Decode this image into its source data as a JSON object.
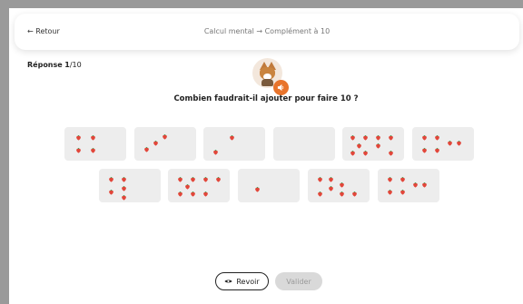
{
  "header": {
    "back_label": "← Retour",
    "breadcrumb": "Calcul mental → Complément à 10"
  },
  "progress": {
    "label": "Réponse",
    "current": "1",
    "total": "/10"
  },
  "question": "Combien faudrait-il ajouter pour faire 10 ?",
  "cards": [
    {
      "strawberries": 4
    },
    {
      "strawberries": 3
    },
    {
      "strawberries": 2
    },
    {
      "strawberries": 0
    },
    {
      "strawberries": 9
    },
    {
      "strawberries": 6
    },
    {
      "strawberries": 5
    },
    {
      "strawberries": 8
    },
    {
      "strawberries": 1
    },
    {
      "strawberries": 7
    },
    {
      "strawberries": 6
    }
  ],
  "buttons": {
    "review_label": "Revoir",
    "validate_label": "Valider"
  },
  "colors": {
    "accent": "#e8742c",
    "card_bg": "#ededed",
    "strawberry": "#e2463a",
    "leaf": "#3a8a3a"
  }
}
